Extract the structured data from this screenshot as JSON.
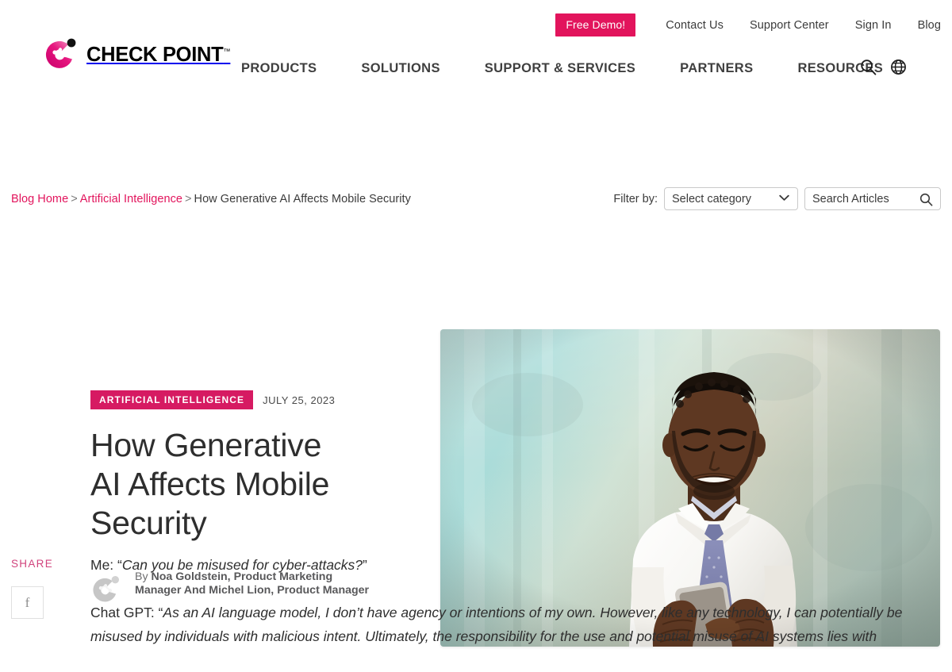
{
  "header": {
    "logo": {
      "text": "CHECK POINT",
      "tm": "™",
      "icon": "checkpoint-logo-icon"
    },
    "free_demo_label": "Free Demo!",
    "util_links": [
      {
        "label": "Contact Us",
        "name": "contact-us"
      },
      {
        "label": "Support Center",
        "name": "support-center"
      },
      {
        "label": "Sign In",
        "name": "sign-in"
      },
      {
        "label": "Blog",
        "name": "blog"
      }
    ],
    "nav_items": [
      {
        "label": "PRODUCTS",
        "name": "products"
      },
      {
        "label": "SOLUTIONS",
        "name": "solutions"
      },
      {
        "label": "SUPPORT & SERVICES",
        "name": "support-services"
      },
      {
        "label": "PARTNERS",
        "name": "partners"
      },
      {
        "label": "RESOURCES",
        "name": "resources"
      }
    ],
    "icons": {
      "search": "search-icon",
      "language": "globe-icon"
    },
    "colors": {
      "brand_pink": "#e2145c",
      "badge_pink": "#d61a62",
      "text_dark": "#3b3b3b"
    }
  },
  "breadcrumb": {
    "home": "Blog Home",
    "sep": ">",
    "category": "Artificial Intelligence",
    "current": "How Generative AI Affects Mobile Security"
  },
  "filter": {
    "label": "Filter by:",
    "category_selected": "Select category",
    "search_placeholder": "Search Articles",
    "search_value": ""
  },
  "article": {
    "category_badge": "ARTIFICIAL INTELLIGENCE",
    "date": "JULY 25, 2023",
    "title": "How Generative AI Affects Mobile Security",
    "byline_prefix": "By",
    "byline_authors": "Noa Goldstein, Product Marketing Manager And Michel Lion, Product Manager",
    "hero_alt": "Smiling man in white shirt and purple tie using a smartphone against a teal textured wall"
  },
  "share": {
    "label": "SHARE",
    "buttons": [
      {
        "label": "f",
        "name": "share-facebook-button"
      }
    ]
  },
  "body": {
    "paragraphs": [
      {
        "lead": "Me: “",
        "quote": "Can you be misused for cyber-attacks?",
        "tail": "”"
      },
      {
        "lead": "Chat GPT: “",
        "quote": "As an AI language model, I don’t have agency or intentions of my own. However, like any technology, I can potentially be misused by individuals with malicious intent. Ultimately, the responsibility for the use and potential misuse of AI systems lies with",
        "tail": ""
      }
    ]
  }
}
